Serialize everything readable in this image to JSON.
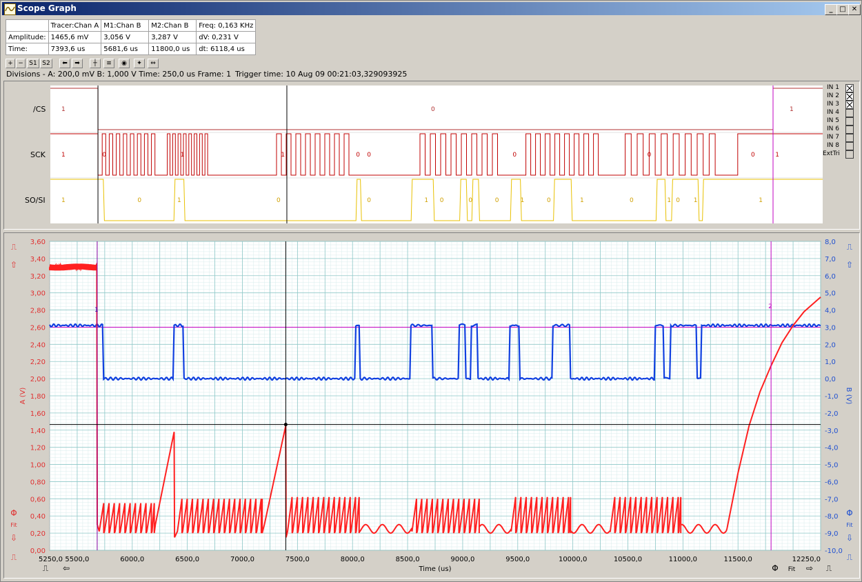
{
  "window": {
    "title": "Scope Graph",
    "minimize": "_",
    "maximize": "□",
    "close": "✕"
  },
  "readout": {
    "rows": [
      [
        "",
        "Tracer:Chan A",
        "M1:Chan B",
        "M2:Chan B",
        "Freq: 0,163 KHz"
      ],
      [
        "Amplitude:",
        "1465,6 mV",
        "3,056 V",
        "3,287 V",
        "dV: 0,231 V"
      ],
      [
        "Time:",
        "7393,6 us",
        "5681,6 us",
        "11800,0 us",
        "dt:  6118,4 us"
      ]
    ]
  },
  "toolbar": {
    "buttons": [
      {
        "label": "+",
        "name": "zoom-in-button"
      },
      {
        "label": "−",
        "name": "zoom-out-button"
      },
      {
        "label": "S1",
        "name": "s1-button"
      },
      {
        "label": "S2",
        "name": "s2-button"
      },
      {
        "label": "⬅",
        "name": "scroll-left-button"
      },
      {
        "label": "➡",
        "name": "scroll-right-button"
      },
      {
        "label": "┼",
        "name": "cursor-button"
      },
      {
        "label": "≡",
        "name": "list-button"
      },
      {
        "label": "◉",
        "name": "marker-button"
      },
      {
        "label": "✦",
        "name": "star-button"
      },
      {
        "label": "⇔",
        "name": "span-button"
      }
    ]
  },
  "info": {
    "divisions": "Divisions -  A: 200,0 mV   B: 1,000 V   Time: 250,0 us   Frame: 1",
    "trigger": "Trigger time: 10 Aug 09 00:21:03,329093925"
  },
  "logic": {
    "channels": [
      {
        "name": "/CS",
        "color": "#b03030"
      },
      {
        "name": "SCK",
        "color": "#c00000"
      },
      {
        "name": "SO/SI",
        "color": "#e8c000"
      }
    ],
    "cs_labels": [
      {
        "text": "1",
        "t": 5350
      },
      {
        "text": "0",
        "t": 8700
      },
      {
        "text": "1",
        "t": 11950
      }
    ],
    "sck_labels": [
      {
        "text": "1",
        "t": 5350
      },
      {
        "text": "0",
        "t": 5720
      },
      {
        "text": "1",
        "t": 6430
      },
      {
        "text": "1",
        "t": 7340
      },
      {
        "text": "0",
        "t": 8020
      },
      {
        "text": "0",
        "t": 8120
      },
      {
        "text": "0",
        "t": 9440
      },
      {
        "text": "0",
        "t": 10660
      },
      {
        "text": "0",
        "t": 11600
      },
      {
        "text": "1",
        "t": 11820
      }
    ],
    "sosi_labels": [
      {
        "text": "1",
        "t": 5350
      },
      {
        "text": "0",
        "t": 6040
      },
      {
        "text": "1",
        "t": 6400
      },
      {
        "text": "0",
        "t": 7300
      },
      {
        "text": "0",
        "t": 8120
      },
      {
        "text": "1",
        "t": 8640
      },
      {
        "text": "0",
        "t": 8780
      },
      {
        "text": "0",
        "t": 9040
      },
      {
        "text": "0",
        "t": 9280
      },
      {
        "text": "1",
        "t": 9510
      },
      {
        "text": "0",
        "t": 9750
      },
      {
        "text": "1",
        "t": 10050
      },
      {
        "text": "0",
        "t": 10500
      },
      {
        "text": "1",
        "t": 10840
      },
      {
        "text": "0",
        "t": 10920
      },
      {
        "text": "1",
        "t": 11080
      },
      {
        "text": "1",
        "t": 11670
      }
    ],
    "inputs": [
      "IN 1",
      "IN 2",
      "IN 3",
      "IN 4",
      "IN 5",
      "IN 6",
      "IN 7",
      "IN 8",
      "ExtTri"
    ],
    "inputs_checked": [
      true,
      true,
      true,
      false,
      false,
      false,
      false,
      false,
      false
    ]
  },
  "chart_data": {
    "type": "line",
    "xlabel": "Time (us)",
    "ylabel_left": "A (V)",
    "ylabel_right": "B (V)",
    "xlim": [
      5250,
      12250
    ],
    "ylim_left": [
      0,
      3.6
    ],
    "ylim_right": [
      -10,
      8
    ],
    "x_ticks": [
      "5250,0",
      "5500,0",
      "6000,0",
      "6500,0",
      "7000,0",
      "7500,0",
      "8000,0",
      "8500,0",
      "9000,0",
      "9500,0",
      "10000,0",
      "10500,0",
      "11000,0",
      "11500,0",
      "12250,0"
    ],
    "y_left_ticks": [
      "0,00",
      "0,20",
      "0,40",
      "0,60",
      "0,80",
      "1,00",
      "1,20",
      "1,40",
      "1,60",
      "1,80",
      "2,00",
      "2,20",
      "2,40",
      "2,60",
      "2,80",
      "3,00",
      "3,20",
      "3,40",
      "3,60"
    ],
    "y_right_ticks": [
      "-10,0",
      "-9,0",
      "-8,0",
      "-7,0",
      "-6,0",
      "-5,0",
      "-4,0",
      "-3,0",
      "-2,0",
      "-1,0",
      "0,0",
      "1,0",
      "2,0",
      "3,0",
      "4,0",
      "5,0",
      "6,0",
      "7,0",
      "8,0"
    ],
    "grid": true,
    "series": [
      {
        "name": "Chan A",
        "color": "#ff2020",
        "axis": "left",
        "x": [
          5250,
          5680,
          5700,
          5720,
          6350,
          6380,
          6390,
          6400,
          7390,
          7400,
          7420,
          8050,
          8550,
          9150,
          9450,
          10150,
          10350,
          10950,
          11000,
          11400,
          11600,
          11800,
          12000,
          12250
        ],
        "y": [
          3.3,
          3.3,
          1.2,
          0.3,
          0.3,
          1.4,
          0.1,
          0.3,
          1.45,
          0.15,
          0.3,
          0.3,
          0.25,
          0.3,
          0.25,
          0.25,
          0.3,
          0.3,
          0.25,
          0.25,
          1.5,
          2.2,
          2.7,
          2.95
        ]
      },
      {
        "name": "Chan B",
        "color": "#1040e0",
        "axis": "right",
        "x": [
          5250,
          5730,
          5740,
          6370,
          6380,
          6460,
          6470,
          8020,
          8030,
          8060,
          8070,
          8520,
          8530,
          8720,
          8730,
          8960,
          8970,
          9020,
          9030,
          9070,
          9080,
          9130,
          9140,
          9420,
          9430,
          9510,
          9520,
          9810,
          9820,
          9970,
          9980,
          10740,
          10750,
          10820,
          10830,
          10880,
          10890,
          11120,
          11130,
          11160,
          11170,
          12250
        ],
        "y": [
          3.1,
          3.1,
          0.0,
          0.0,
          3.1,
          3.1,
          0.0,
          0.0,
          3.1,
          3.1,
          0.0,
          0.0,
          3.1,
          3.1,
          0.0,
          0.0,
          3.1,
          3.1,
          0.0,
          0.0,
          3.1,
          3.1,
          0.0,
          0.0,
          3.1,
          3.1,
          0.0,
          0.0,
          3.1,
          3.1,
          0.0,
          0.0,
          3.1,
          3.1,
          0.0,
          0.0,
          3.1,
          3.1,
          0.0,
          0.0,
          3.1,
          3.1
        ]
      }
    ],
    "cursors": {
      "tracer_time": 7393.6,
      "tracer_value": 1.4656,
      "m1_time": 5681.6,
      "m2_time": 11800.0,
      "trigger_level_b": 3.0
    },
    "marker_labels": {
      "m1": "1",
      "m2": "2"
    }
  },
  "side_controls": {
    "left": [
      "trigger-up",
      "arrow-up",
      "phase",
      "fit",
      "arrow-down",
      "trigger-down"
    ],
    "fit_label": "Fit",
    "phase_label": "Φ"
  }
}
